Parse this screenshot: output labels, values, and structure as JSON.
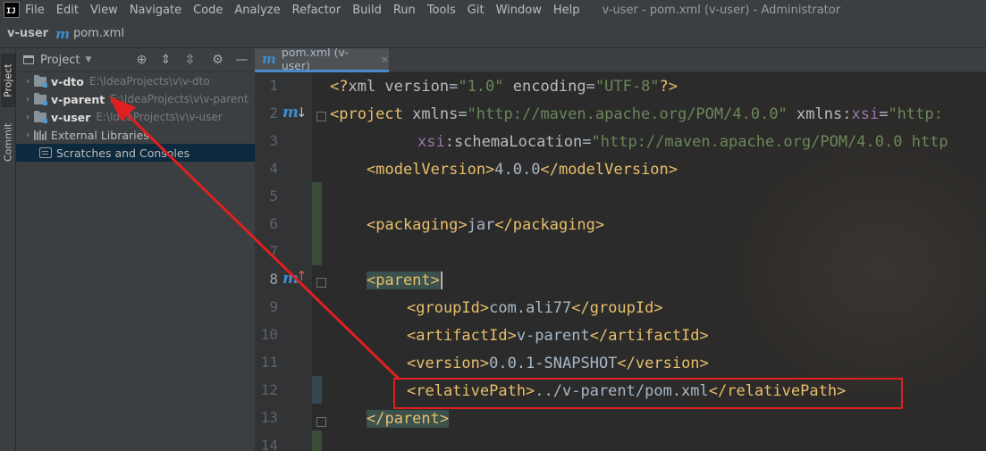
{
  "app": {
    "logo_text": "IJ",
    "window_title": "v-user - pom.xml (v-user) - Administrator"
  },
  "menu": [
    "File",
    "Edit",
    "View",
    "Navigate",
    "Code",
    "Analyze",
    "Refactor",
    "Build",
    "Run",
    "Tools",
    "Git",
    "Window",
    "Help"
  ],
  "breadcrumb": {
    "project": "v-user",
    "file_icon": "m",
    "file": "pom.xml"
  },
  "left_strip": {
    "tabs": [
      "Project",
      "Commit"
    ]
  },
  "project_panel": {
    "title": "Project",
    "tools": [
      "target-icon",
      "expand-all-icon",
      "collapse-all-icon",
      "gear-icon",
      "minimize-icon"
    ],
    "tree": [
      {
        "name": "v-dto",
        "path": "E:\\IdeaProjects\\v\\v-dto",
        "type": "module"
      },
      {
        "name": "v-parent",
        "path": "E:\\IdeaProjects\\v\\v-parent",
        "type": "module"
      },
      {
        "name": "v-user",
        "path": "E:\\IdeaProjects\\v\\v-user",
        "type": "module"
      },
      {
        "name": "External Libraries",
        "path": "",
        "type": "libraries"
      },
      {
        "name": "Scratches and Consoles",
        "path": "",
        "type": "scratches",
        "selected": true
      }
    ]
  },
  "editor": {
    "tab": {
      "icon": "m",
      "label": "pom.xml (v-user)",
      "close": "×"
    },
    "line_numbers": [
      "1",
      "2",
      "3",
      "4",
      "5",
      "6",
      "7",
      "8",
      "9",
      "10",
      "11",
      "12",
      "13",
      "14"
    ],
    "code": {
      "l1": {
        "a": "<?",
        "b": "xml version",
        "c": "=",
        "d": "\"1.0\"",
        "e": " encoding",
        "f": "=",
        "g": "\"UTF-8\"",
        "h": "?>"
      },
      "l2": {
        "a": "<project",
        "b": " xmlns",
        "c": "=",
        "d": "\"http://maven.apache.org/POM/4.0.0\"",
        "e": " xmlns",
        "f": ":",
        "g": "xsi",
        "h": "=",
        "i": "\"http:"
      },
      "l3": {
        "a": "xsi",
        "b": ":schemaLocation",
        "c": "=",
        "d": "\"http://maven.apache.org/POM/4.0.0 http"
      },
      "l4": {
        "open": "<modelVersion>",
        "text": "4.0.0",
        "close": "</modelVersion>"
      },
      "l6": {
        "open": "<packaging>",
        "text": "jar",
        "close": "</packaging>"
      },
      "l8": {
        "open": "<parent>"
      },
      "l9": {
        "open": "<groupId>",
        "text": "com.ali77",
        "close": "</groupId>"
      },
      "l10": {
        "open": "<artifactId>",
        "text": "v-parent",
        "close": "</artifactId>"
      },
      "l11": {
        "open": "<version>",
        "text": "0.0.1-SNAPSHOT",
        "close": "</version>"
      },
      "l12": {
        "open": "<relativePath>",
        "text": "../v-parent/pom.xml",
        "close": "</relativePath>"
      },
      "l13": {
        "close": "</parent>"
      }
    }
  },
  "annotation": {
    "color": "#e02020"
  }
}
